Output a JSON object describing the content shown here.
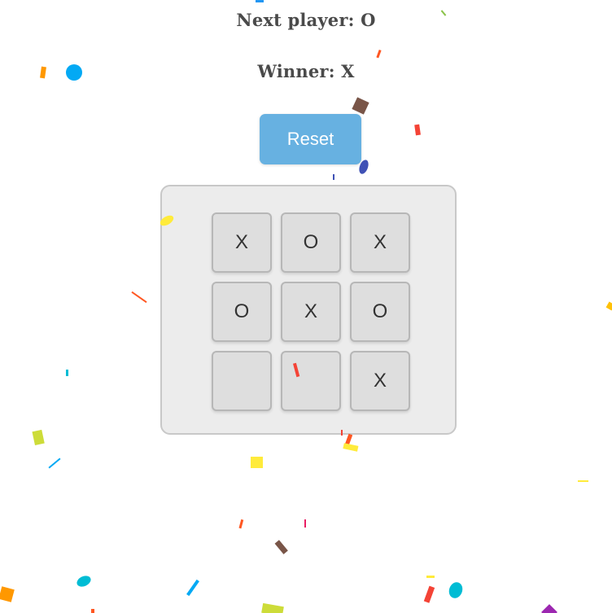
{
  "game": {
    "next_player_text": "Next player: O",
    "winner_text": "Winner: X",
    "reset_label": "Reset",
    "board": [
      "X",
      "O",
      "X",
      "O",
      "X",
      "O",
      "",
      "",
      "X"
    ]
  },
  "colors": {
    "reset_button": "#67b1e1",
    "board_background": "#ececec",
    "cell_background": "#dedede",
    "status_text": "#4a4a4a"
  }
}
